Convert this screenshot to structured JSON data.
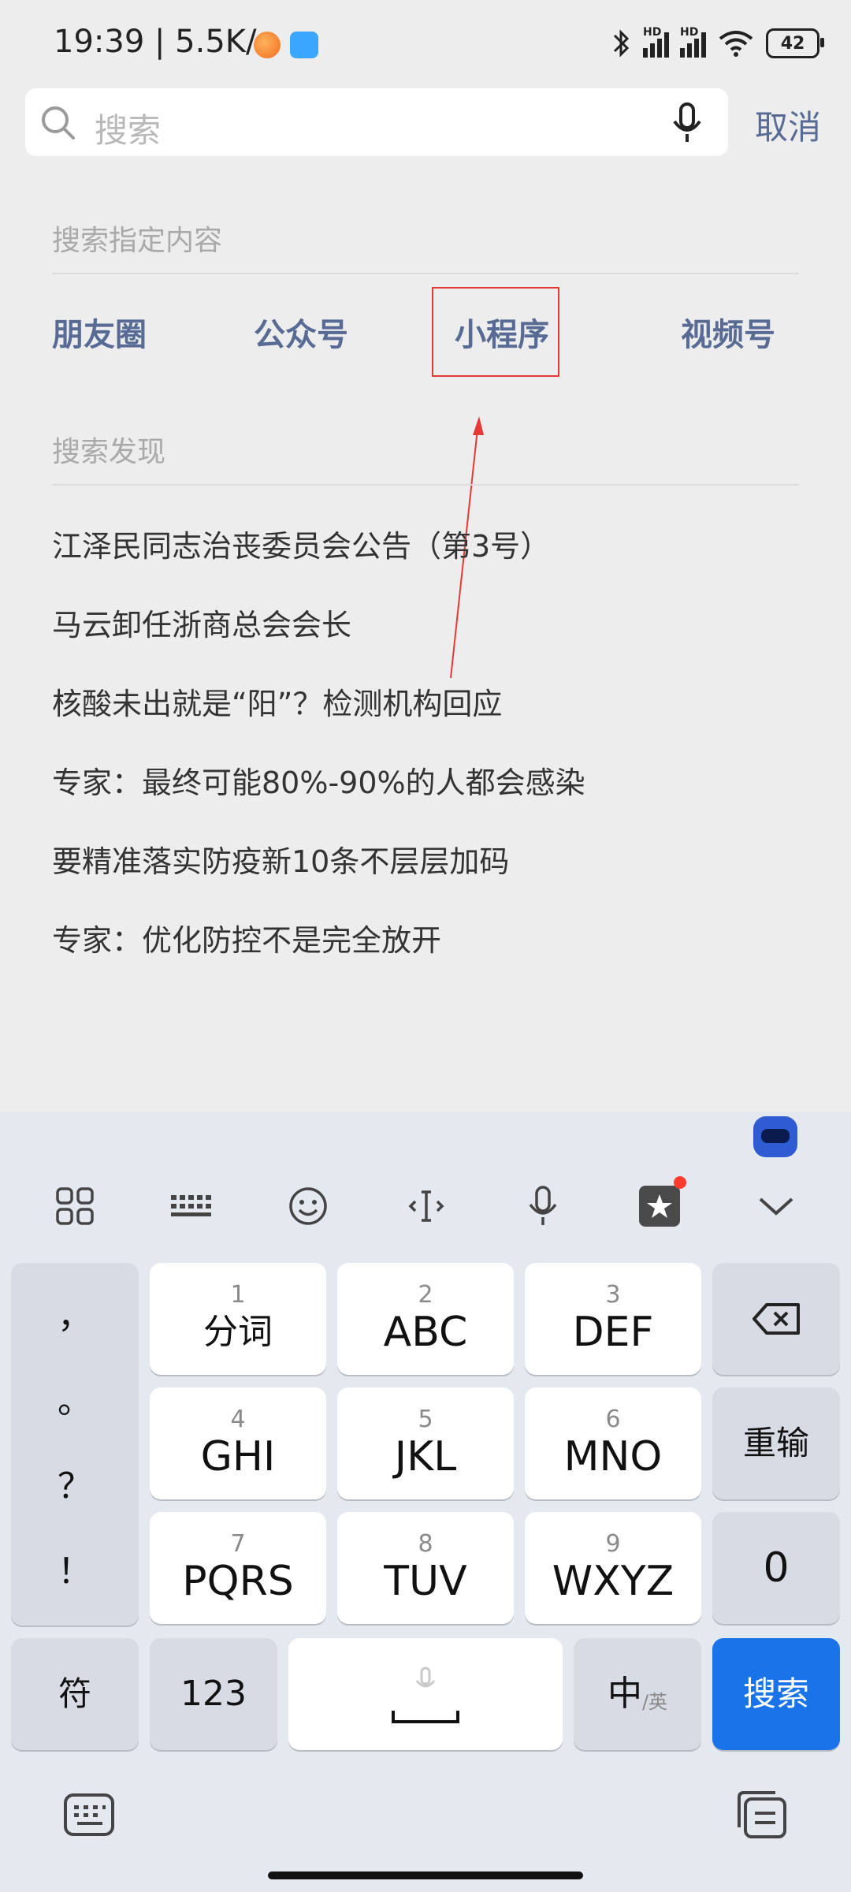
{
  "status_bar": {
    "time": "19:39 | 5.5K/s",
    "battery": "42",
    "hd1": "HD",
    "hd2": "HD"
  },
  "search": {
    "placeholder": "搜索",
    "cancel_label": "取消"
  },
  "specified": {
    "title": "搜索指定内容",
    "categories": [
      "朋友圈",
      "公众号",
      "小程序",
      "视频号"
    ]
  },
  "discover": {
    "title": "搜索发现",
    "items": [
      "江泽民同志治丧委员会公告（第3号）",
      "马云卸任浙商总会会长",
      "核酸未出就是“阳”？检测机构回应",
      "专家：最终可能80%-90%的人都会感染",
      "要精准落实防疫新10条不层层加码",
      "专家：优化防控不是完全放开"
    ]
  },
  "keyboard": {
    "side_punct": [
      "，",
      "。",
      "？",
      "！"
    ],
    "keys": [
      {
        "num": "1",
        "label": "分词"
      },
      {
        "num": "2",
        "label": "ABC"
      },
      {
        "num": "3",
        "label": "DEF"
      },
      {
        "num": "4",
        "label": "GHI"
      },
      {
        "num": "5",
        "label": "JKL"
      },
      {
        "num": "6",
        "label": "MNO"
      },
      {
        "num": "7",
        "label": "PQRS"
      },
      {
        "num": "8",
        "label": "TUV"
      },
      {
        "num": "9",
        "label": "WXYZ"
      }
    ],
    "reenter": "重输",
    "zero": "0",
    "symbols": "符",
    "numbers": "123",
    "lang_main": "中",
    "lang_sub": "/英",
    "search": "搜索"
  },
  "colors": {
    "link": "#576b95",
    "accent": "#1a73e8",
    "annotation": "#e53935"
  }
}
